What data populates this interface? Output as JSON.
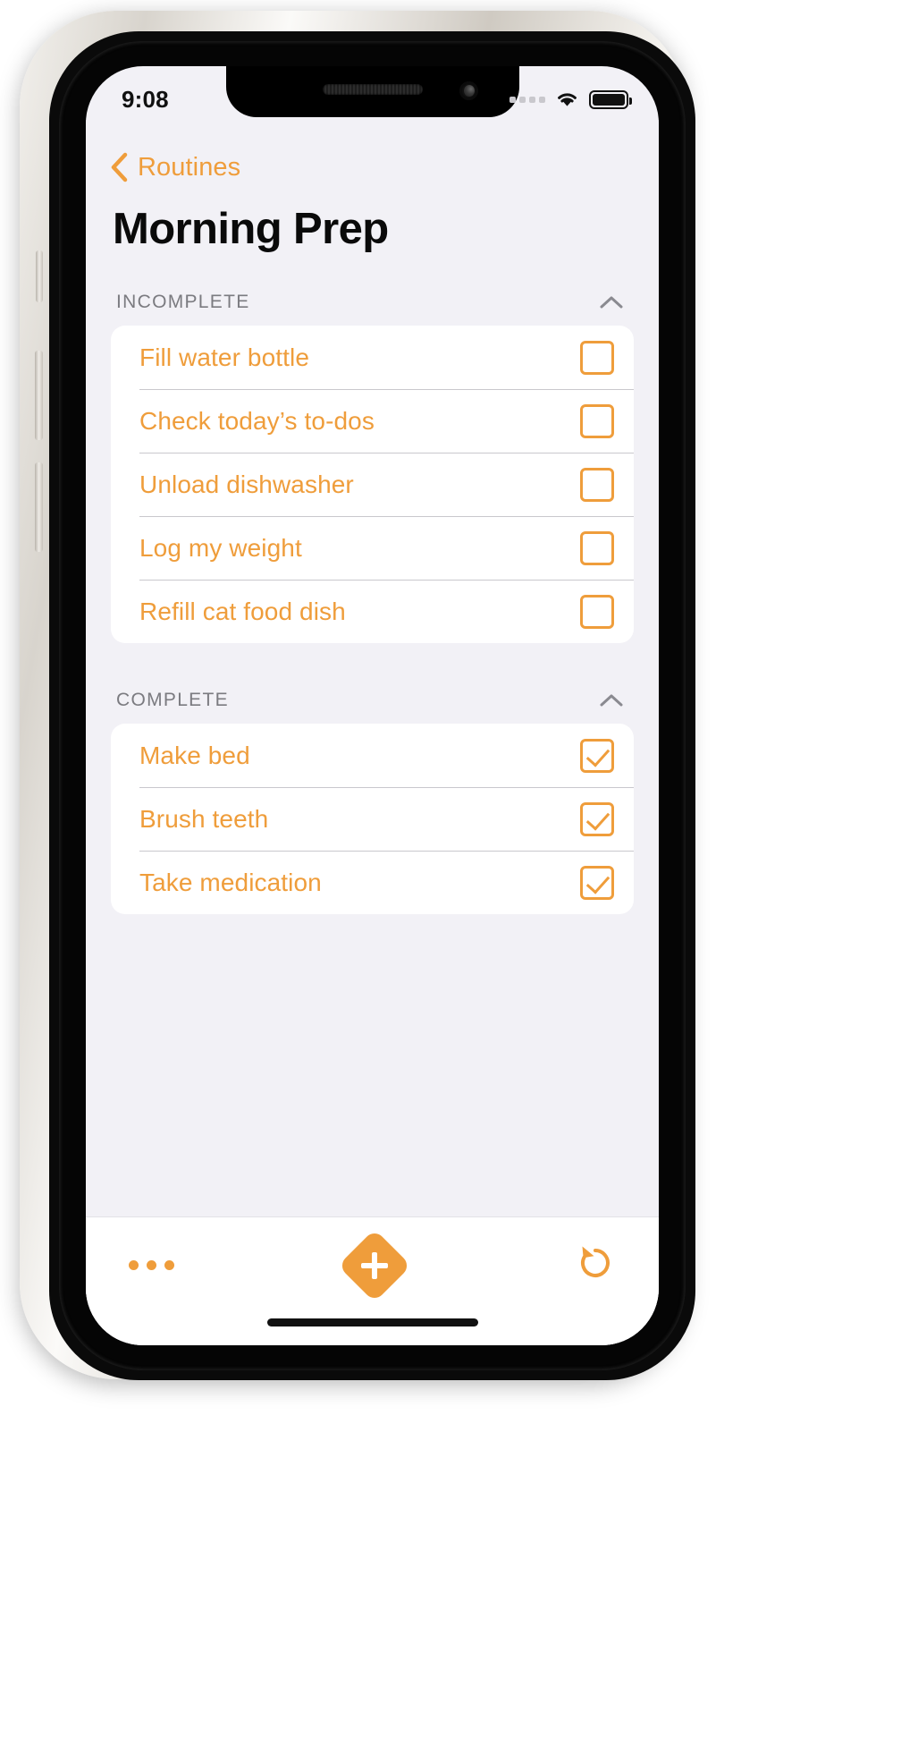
{
  "statusbar": {
    "time": "9:08",
    "signal_icon": "signal-dots-icon",
    "wifi_icon": "wifi-icon",
    "battery_icon": "battery-full-icon"
  },
  "nav": {
    "back_label": "Routines",
    "back_icon": "chevron-left-icon"
  },
  "header": {
    "title": "Morning Prep"
  },
  "theme": {
    "accent": "#ef9d3b",
    "background": "#f2f1f6",
    "card": "#ffffff",
    "section_label": "#7b7b80",
    "divider": "#c9c8cd"
  },
  "sections": [
    {
      "label": "INCOMPLETE",
      "collapse_icon": "chevron-up-icon",
      "items": [
        {
          "label": "Fill water bottle",
          "checked": false,
          "checkbox_icon": "checkbox-empty-icon"
        },
        {
          "label": "Check today’s to-dos",
          "checked": false,
          "checkbox_icon": "checkbox-empty-icon"
        },
        {
          "label": "Unload dishwasher",
          "checked": false,
          "checkbox_icon": "checkbox-empty-icon"
        },
        {
          "label": "Log my weight",
          "checked": false,
          "checkbox_icon": "checkbox-empty-icon"
        },
        {
          "label": "Refill cat food dish",
          "checked": false,
          "checkbox_icon": "checkbox-empty-icon"
        }
      ]
    },
    {
      "label": "COMPLETE",
      "collapse_icon": "chevron-up-icon",
      "items": [
        {
          "label": "Make bed",
          "checked": true,
          "checkbox_icon": "checkbox-checked-icon"
        },
        {
          "label": "Brush teeth",
          "checked": true,
          "checkbox_icon": "checkbox-checked-icon"
        },
        {
          "label": "Take medication",
          "checked": true,
          "checkbox_icon": "checkbox-checked-icon"
        }
      ]
    }
  ],
  "toolbar": {
    "more_icon": "ellipsis-icon",
    "add_icon": "plus-diamond-icon",
    "reset_icon": "rotate-counterclockwise-icon"
  }
}
